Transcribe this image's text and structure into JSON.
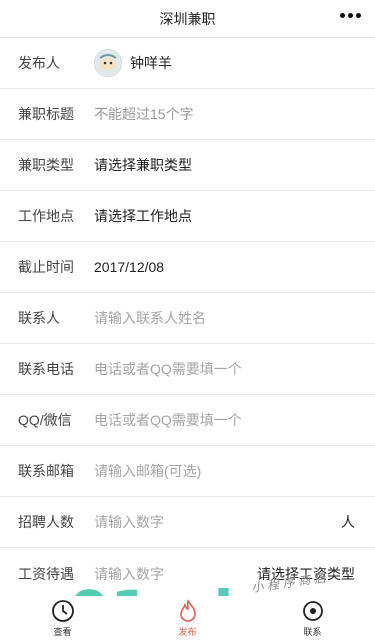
{
  "nav": {
    "title": "深圳兼职"
  },
  "form": {
    "publisher": {
      "label": "发布人",
      "name": "钟咩羊"
    },
    "title": {
      "label": "兼职标题",
      "placeholder": "不能超过15个字"
    },
    "type": {
      "label": "兼职类型",
      "value": "请选择兼职类型"
    },
    "location": {
      "label": "工作地点",
      "value": "请选择工作地点"
    },
    "deadline": {
      "label": "截止时间",
      "value": "2017/12/08"
    },
    "contact": {
      "label": "联系人",
      "placeholder": "请输入联系人姓名"
    },
    "phone": {
      "label": "联系电话",
      "placeholder": "电话或者QQ需要填一个"
    },
    "qq": {
      "label": "QQ/微信",
      "placeholder": "电话或者QQ需要填一个"
    },
    "email": {
      "label": "联系邮箱",
      "placeholder": "请输入邮箱(可选)"
    },
    "recruits": {
      "label": "招聘人数",
      "placeholder": "请输入数字",
      "unit": "人"
    },
    "salary": {
      "label": "工资待遇",
      "placeholder": "请输入数字",
      "type_select": "请选择工资类型"
    }
  },
  "tabbar": {
    "items": [
      {
        "label": "查看",
        "icon": "clock-icon"
      },
      {
        "label": "发布",
        "icon": "fire-icon"
      },
      {
        "label": "联系",
        "icon": "location-icon"
      }
    ]
  },
  "watermark": {
    "text": "91ud.com",
    "subtext": "小 程 序 商 店"
  }
}
